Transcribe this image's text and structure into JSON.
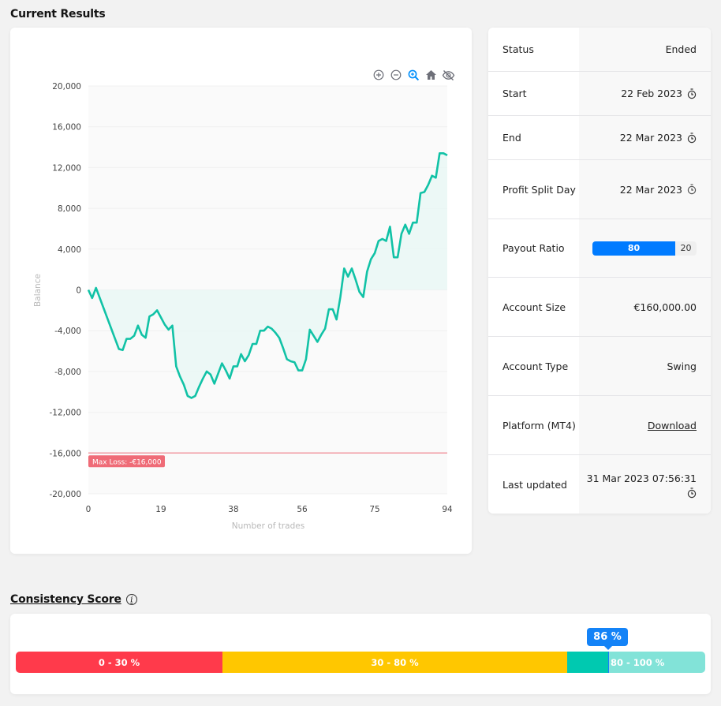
{
  "sections": {
    "current_results": "Current Results",
    "consistency_score": "Consistency Score"
  },
  "toolbar": {
    "icons": [
      "zoom-in-icon",
      "zoom-out-icon",
      "selection-zoom-icon",
      "home-reset-icon",
      "pan-hide-icon"
    ]
  },
  "chart_data": {
    "type": "area",
    "title": "",
    "xlabel": "Number of trades",
    "ylabel": "Balance",
    "xlim": [
      0,
      94
    ],
    "ylim": [
      -20000,
      20000
    ],
    "x_ticks": [
      "0",
      "19",
      "38",
      "56",
      "75",
      "94"
    ],
    "x_tick_values": [
      0,
      19,
      38,
      56,
      75,
      94
    ],
    "y_ticks": [
      "20,000",
      "16,000",
      "12,000",
      "8,000",
      "4,000",
      "0",
      "-4,000",
      "-8,000",
      "-12,000",
      "-16,000",
      "-20,000"
    ],
    "y_tick_values": [
      20000,
      16000,
      12000,
      8000,
      4000,
      0,
      -4000,
      -8000,
      -12000,
      -16000,
      -20000
    ],
    "grid": true,
    "line_color": "#11c2a6",
    "fill_color": "#e9f7f5",
    "annotation": {
      "label": "Max Loss: -€16,000",
      "y": -16000,
      "color": "#ef6b77"
    },
    "series": [
      {
        "name": "Balance",
        "values": [
          0,
          -800,
          200,
          -800,
          -1800,
          -2800,
          -3800,
          -4800,
          -5800,
          -5900,
          -4800,
          -4800,
          -4500,
          -3500,
          -4400,
          -4700,
          -2600,
          -2400,
          -2000,
          -2700,
          -3400,
          -3900,
          -3500,
          -7500,
          -8500,
          -9300,
          -10400,
          -10600,
          -10400,
          -9500,
          -8700,
          -8000,
          -8300,
          -9200,
          -8200,
          -7200,
          -7900,
          -8700,
          -7500,
          -7500,
          -6300,
          -7000,
          -6400,
          -5300,
          -5300,
          -4000,
          -4000,
          -3600,
          -3800,
          -4200,
          -4700,
          -5700,
          -6800,
          -7000,
          -7100,
          -7900,
          -7900,
          -6800,
          -3900,
          -4500,
          -5100,
          -4400,
          -3800,
          -1900,
          -1900,
          -2900,
          -700,
          2100,
          1300,
          2100,
          1000,
          -200,
          -700,
          1800,
          3000,
          3600,
          4800,
          5000,
          4800,
          6200,
          3200,
          3200,
          5500,
          6400,
          5500,
          6600,
          6600,
          9500,
          9600,
          10300,
          11200,
          11000,
          13400,
          13400,
          13200
        ]
      }
    ]
  },
  "info": {
    "rows": [
      {
        "label": "Status",
        "value": "Ended"
      },
      {
        "label": "Start",
        "value": "22 Feb 2023"
      },
      {
        "label": "End",
        "value": "22 Mar 2023"
      },
      {
        "label": "Profit Split Day",
        "value": "22 Mar 2023"
      },
      {
        "label": "Payout Ratio",
        "value_main": "80",
        "value_rest": "20"
      },
      {
        "label": "Account Size",
        "value": "€160,000.00"
      },
      {
        "label": "Account Type",
        "value": "Swing"
      },
      {
        "label": "Platform (MT4)",
        "value": "Download"
      },
      {
        "label": "Last updated",
        "value": "31 Mar 2023 07:56:31"
      }
    ],
    "payout_ratio_percent": 80
  },
  "consistency": {
    "segments": [
      {
        "label": "0 - 30 %",
        "color": "#ff3a4b"
      },
      {
        "label": "30 - 80 %",
        "color": "#ffc700"
      },
      {
        "label": "",
        "color": "#00c9b0"
      },
      {
        "label": "80 - 100 %",
        "color": "#82e3d8"
      }
    ],
    "score_label": "86 %",
    "score_percent": 86,
    "info_icon": "i"
  }
}
